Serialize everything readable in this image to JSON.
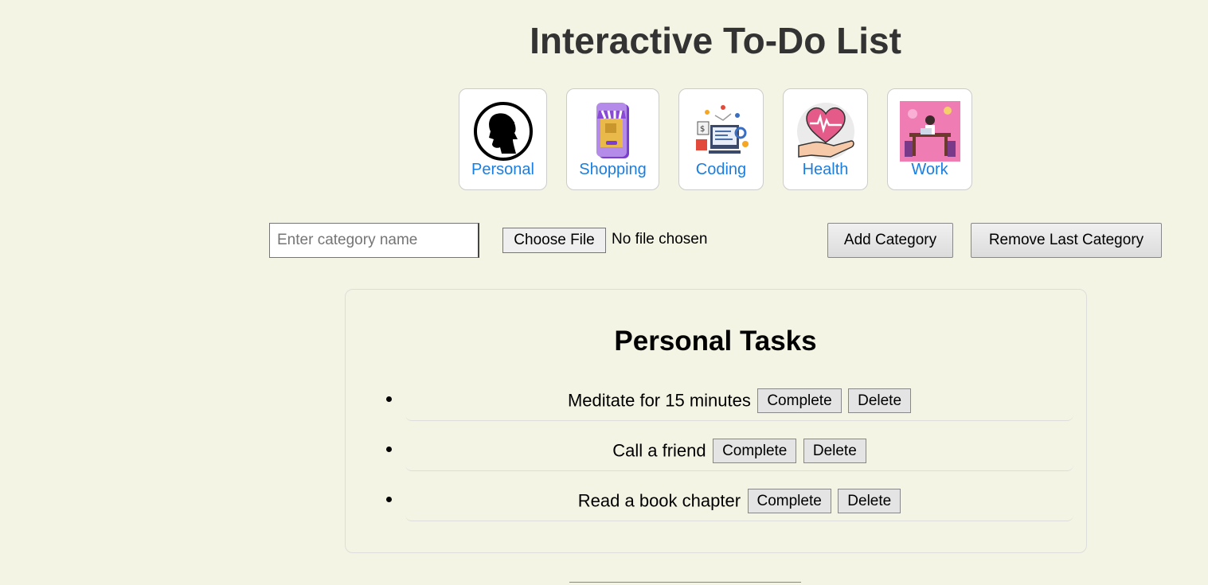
{
  "page": {
    "title": "Interactive To-Do List"
  },
  "categories": [
    {
      "label": "Personal",
      "icon": "person-silhouette-icon"
    },
    {
      "label": "Shopping",
      "icon": "shopping-phone-icon"
    },
    {
      "label": "Coding",
      "icon": "coding-illustration-icon"
    },
    {
      "label": "Health",
      "icon": "heart-hand-icon"
    },
    {
      "label": "Work",
      "icon": "workspace-illustration-icon"
    }
  ],
  "form": {
    "category_placeholder": "Enter category name",
    "category_value": "",
    "file_button": "Choose File",
    "file_status": "No file chosen",
    "add_button": "Add Category",
    "remove_button": "Remove Last Category"
  },
  "tasks_panel": {
    "title": "Personal Tasks",
    "complete_label": "Complete",
    "delete_label": "Delete",
    "items": [
      {
        "text": "Meditate for 15 minutes"
      },
      {
        "text": "Call a friend"
      },
      {
        "text": "Read a book chapter"
      }
    ]
  },
  "colors": {
    "background": "#f4f4e4",
    "link": "#1a7ee0",
    "title": "#333333"
  }
}
